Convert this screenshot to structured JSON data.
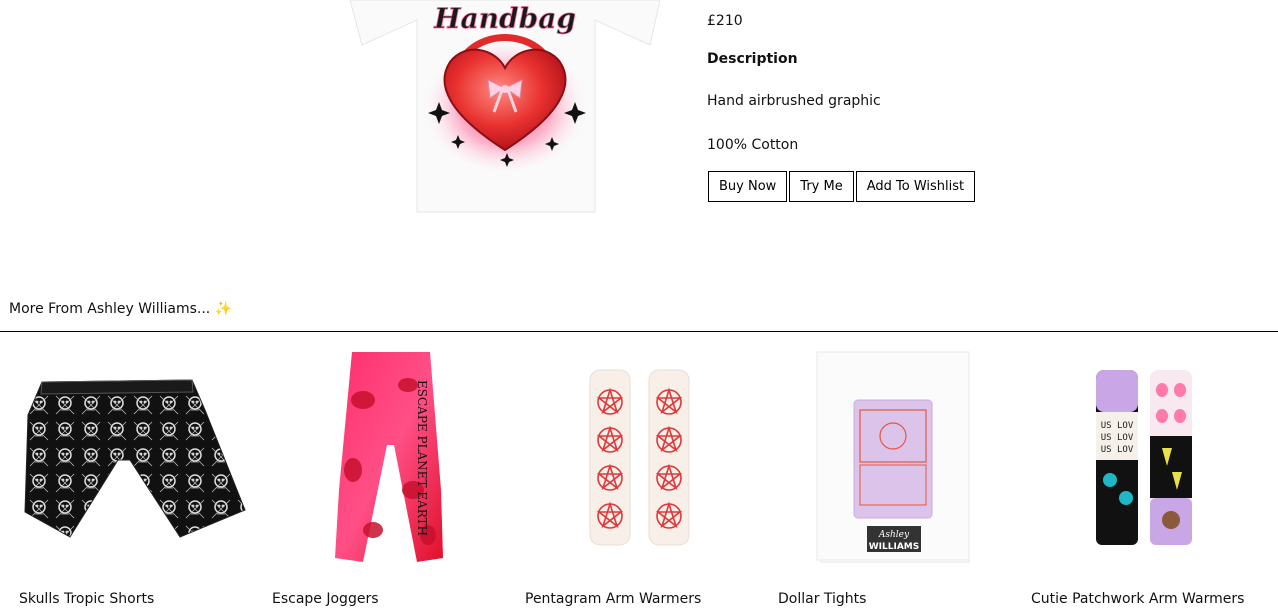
{
  "product": {
    "price": "£210",
    "description_heading": "Description",
    "description_lines": [
      "Hand airbrushed graphic",
      "100% Cotton"
    ],
    "image_text": "Handbag",
    "actions": {
      "buy_now": "Buy Now",
      "try_me": "Try Me",
      "add_to_wishlist": "Add To Wishlist"
    }
  },
  "more_section": {
    "heading": "More From Ashley Williams... ✨",
    "items": [
      {
        "name": "Skulls Tropic Shorts"
      },
      {
        "name": "Escape Joggers",
        "image_text": "ESCAPE PLANET EARTH"
      },
      {
        "name": "Pentagram Arm Warmers"
      },
      {
        "name": "Dollar Tights",
        "image_text": [
          "Ashley",
          "WILLIAMS"
        ]
      },
      {
        "name": "Cutie Patchwork Arm Warmers",
        "image_text": "US LOV"
      }
    ]
  }
}
